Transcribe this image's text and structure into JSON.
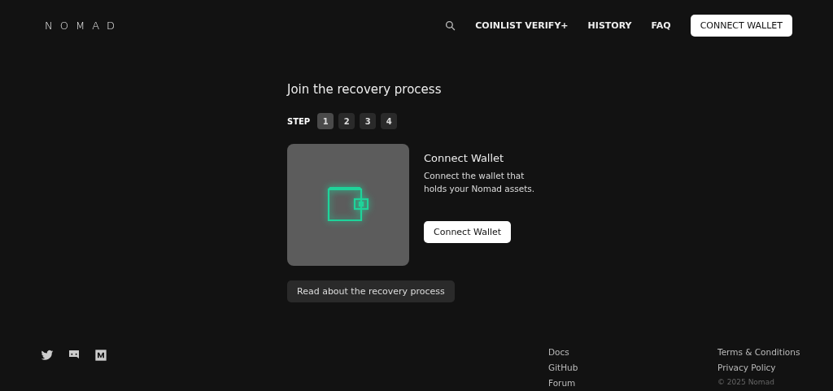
{
  "header": {
    "logo": "NOMAD",
    "nav": [
      "COINLIST VERIFY+",
      "HISTORY",
      "FAQ"
    ],
    "connect_button": "CONNECT WALLET"
  },
  "main": {
    "title": "Join the recovery process",
    "step_label": "STEP",
    "steps": [
      {
        "label": "1",
        "selected": true
      },
      {
        "label": "2",
        "selected": false
      },
      {
        "label": "3",
        "selected": false
      },
      {
        "label": "4",
        "selected": false
      }
    ],
    "card": {
      "title": "Connect Wallet",
      "description": "Connect the wallet that holds your Nomad assets.",
      "button": "Connect Wallet"
    },
    "read_button": "Read about the recovery process"
  },
  "footer": {
    "links_1": [
      "Docs",
      "GitHub",
      "Forum"
    ],
    "links_2": [
      "Terms & Conditions",
      "Privacy Policy"
    ],
    "copyright": "© 2025 Nomad"
  }
}
